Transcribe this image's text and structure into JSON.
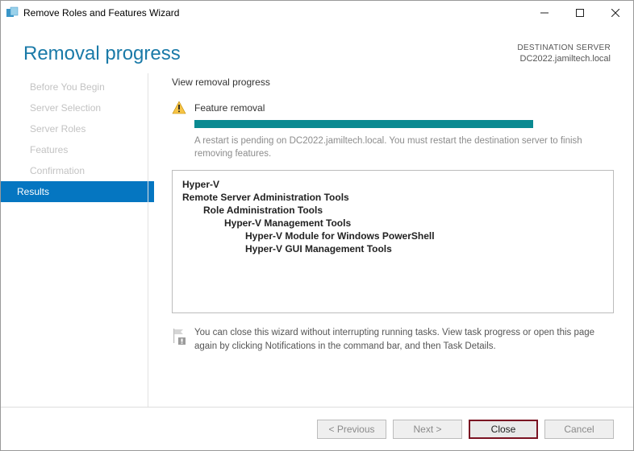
{
  "window": {
    "title": "Remove Roles and Features Wizard"
  },
  "header": {
    "title": "Removal progress",
    "destination_label": "DESTINATION SERVER",
    "destination_value": "DC2022.jamiltech.local"
  },
  "sidebar": {
    "steps": [
      {
        "label": "Before You Begin"
      },
      {
        "label": "Server Selection"
      },
      {
        "label": "Server Roles"
      },
      {
        "label": "Features"
      },
      {
        "label": "Confirmation"
      },
      {
        "label": "Results"
      }
    ]
  },
  "main": {
    "view_label": "View removal progress",
    "status_text": "Feature removal",
    "restart_msg": "A restart is pending on DC2022.jamiltech.local. You must restart the destination server to finish removing features.",
    "results": {
      "l0a": "Hyper-V",
      "l0b": "Remote Server Administration Tools",
      "l1a": "Role Administration Tools",
      "l2a": "Hyper-V Management Tools",
      "l3a": "Hyper-V Module for Windows PowerShell",
      "l3b": "Hyper-V GUI Management Tools"
    },
    "hint": "You can close this wizard without interrupting running tasks. View task progress or open this page again by clicking Notifications in the command bar, and then Task Details."
  },
  "footer": {
    "previous": "< Previous",
    "next": "Next >",
    "close": "Close",
    "cancel": "Cancel"
  }
}
